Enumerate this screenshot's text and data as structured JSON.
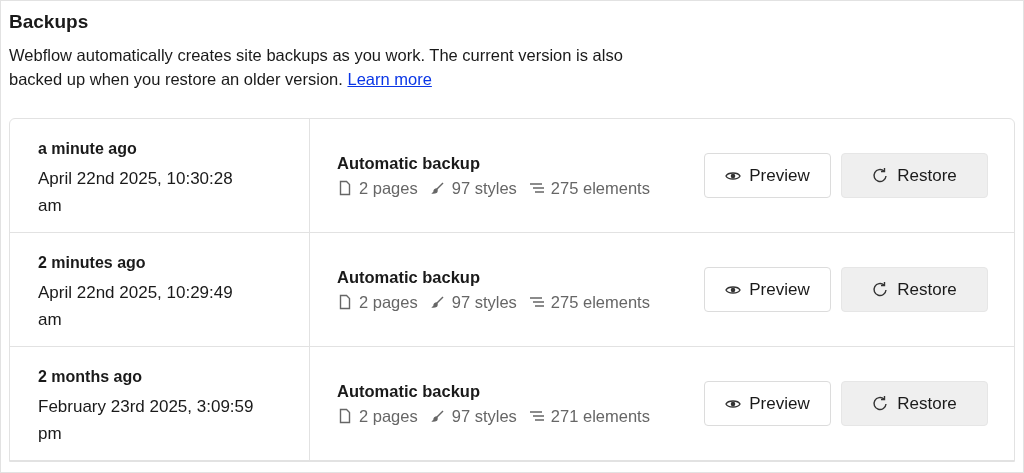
{
  "title": "Backups",
  "description": "Webflow automatically creates site backups as you work. The current version is also backed up when you restore an older version.",
  "learn_more_link": "Learn more",
  "backups": [
    {
      "relative_time": "a minute ago",
      "date": "April 22nd 2025, 10:30:28 am",
      "type": "Automatic backup",
      "pages": "2 pages",
      "styles": "97 styles",
      "elements": "275 elements",
      "preview_button": "Preview",
      "restore_button": "Restore"
    },
    {
      "relative_time": "2 minutes ago",
      "date": "April 22nd 2025, 10:29:49 am",
      "type": "Automatic backup",
      "pages": "2 pages",
      "styles": "97 styles",
      "elements": "275 elements",
      "preview_button": "Preview",
      "restore_button": "Restore"
    },
    {
      "relative_time": "2 months ago",
      "date": "February 23rd 2025, 3:09:59 pm",
      "type": "Automatic backup",
      "pages": "2 pages",
      "styles": "97 styles",
      "elements": "271 elements",
      "preview_button": "Preview",
      "restore_button": "Restore"
    }
  ]
}
